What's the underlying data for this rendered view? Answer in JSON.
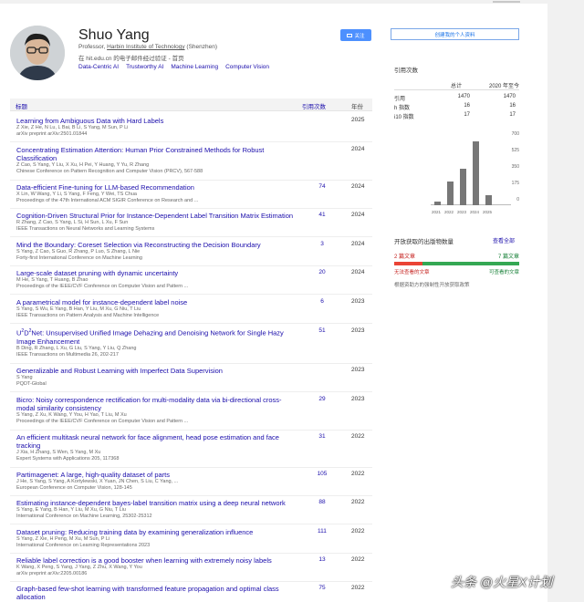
{
  "profile": {
    "name": "Shuo Yang",
    "affiliation_prefix": "Professor, ",
    "affiliation_link": "Harbin Institute of Technology",
    "affiliation_suffix": " (Shenzhen)",
    "email": "在 hit.edu.cn 的电子邮件经过验证 - 首页",
    "interests": [
      "Data-Centric AI",
      "Trustworthy AI",
      "Machine Learning",
      "Computer Vision"
    ],
    "follow_label": "关注",
    "create_profile_label": "创建我的个人资料"
  },
  "table": {
    "col_title": "标题",
    "col_cited": "引用次数",
    "col_year": "年份"
  },
  "publications": [
    {
      "title": "Learning from Ambiguous Data with Hard Labels",
      "authors": "Z Xie, Z He, N Lu, L Bai, B Li, S Yang, M Sun, P Li",
      "venue": "arXiv preprint arXiv:2501.01844",
      "cited": "",
      "year": "2025"
    },
    {
      "title": "Concentrating Estimation Attention: Human Prior Constrained Methods for Robust Classification",
      "authors": "Z Cao, S Yang, Y Liu, X Xu, H Pei, Y Huang, Y Yu, R Zhang",
      "venue": "Chinese Conference on Pattern Recognition and Computer Vision (PRCV), 567-588",
      "cited": "",
      "year": "2024"
    },
    {
      "title": "Data-efficient Fine-tuning for LLM-based Recommendation",
      "authors": "X Lin, W Wang, Y Li, S Yang, F Feng, Y Wei, TS Chua",
      "venue": "Proceedings of the 47th International ACM SIGIR Conference on Research and ...",
      "cited": "74",
      "year": "2024"
    },
    {
      "title": "Cognition-Driven Structural Prior for Instance-Dependent Label Transition Matrix Estimation",
      "authors": "R Zhang, Z Cao, S Yang, L Si, H Sun, L Xu, F Sun",
      "venue": "IEEE Transactions on Neural Networks and Learning Systems",
      "cited": "41",
      "year": "2024"
    },
    {
      "title": "Mind the Boundary: Coreset Selection via Reconstructing the Decision Boundary",
      "authors": "S Yang, Z Cao, S Guo, R Zhang, P Luo, S Zhang, L Nie",
      "venue": "Forty-first International Conference on Machine Learning",
      "cited": "3",
      "year": "2024"
    },
    {
      "title": "Large-scale dataset pruning with dynamic uncertainty",
      "authors": "M He, S Yang, T Huang, B Zhao",
      "venue": "Proceedings of the IEEE/CVF Conference on Computer Vision and Pattern ...",
      "cited": "20",
      "year": "2024"
    },
    {
      "title": "A parametrical model for instance-dependent label noise",
      "authors": "S Yang, S Wu, E Yang, B Han, Y Liu, M Xu, G Niu, T Liu",
      "venue": "IEEE Transactions on Pattern Analysis and Machine Intelligence",
      "cited": "6",
      "year": "2023"
    },
    {
      "title_pre": "U",
      "title_sup1": "2",
      "title_mid": "D",
      "title_sup2": "2",
      "title_post": "Net: Unsupervised Unified Image Dehazing and Denoising Network for Single Hazy Image Enhancement",
      "authors": "B Ding, R Zhang, L Xu, G Liu, S Yang, Y Liu, Q Zhang",
      "venue": "IEEE Transactions on Multimedia 26, 202-217",
      "cited": "51",
      "year": "2023"
    },
    {
      "title": "Generalizable and Robust Learning with Imperfect Data Supervision",
      "authors": "S Yang",
      "venue": "PQDT-Global",
      "cited": "",
      "year": "2023"
    },
    {
      "title": "Bicro: Noisy correspondence rectification for multi-modality data via bi-directional cross-modal similarity consistency",
      "authors": "S Yang, Z Xu, K Wang, Y You, H Yao, T Liu, M Xu",
      "venue": "Proceedings of the IEEE/CVF Conference on Computer Vision and Pattern ...",
      "cited": "29",
      "year": "2023"
    },
    {
      "title": "An efficient multitask neural network for face alignment, head pose estimation and face tracking",
      "authors": "J Xia, H Zhang, S Wen, S Yang, M Xu",
      "venue": "Expert Systems with Applications 205, 117368",
      "cited": "31",
      "year": "2022"
    },
    {
      "title": "Partimagenet: A large, high-quality dataset of parts",
      "authors": "J He, S Yang, S Yang, A Kortylewski, X Yuan, JN Chen, S Liu, C Yang, ...",
      "venue": "European Conference on Computer Vision, 128-145",
      "cited": "105",
      "year": "2022"
    },
    {
      "title": "Estimating instance-dependent bayes-label transition matrix using a deep neural network",
      "authors": "S Yang, E Yang, B Han, Y Liu, M Xu, G Niu, T Liu",
      "venue": "International Conference on Machine Learning, 25302-25312",
      "cited": "88",
      "year": "2022"
    },
    {
      "title": "Dataset pruning: Reducing training data by examining generalization influence",
      "authors": "S Yang, Z Xie, H Peng, M Xu, M Sun, P Li",
      "venue": "International Conference on Learning Representations 2023",
      "cited": "111",
      "year": "2022"
    },
    {
      "title": "Reliable label correction is a good booster when learning with extremely noisy labels",
      "authors": "K Wang, X Peng, S Yang, J Yang, Z Zhu, X Wang, Y You",
      "venue": "arXiv preprint arXiv:2205.00186",
      "cited": "13",
      "year": "2022"
    },
    {
      "title": "Graph-based few-shot learning with transformed feature propagation and optimal class allocation",
      "authors": "",
      "venue": "",
      "cited": "75",
      "year": "2022"
    }
  ],
  "stats": {
    "title": "引用次数",
    "col_all": "总计",
    "col_since": "2020 年至今",
    "rows": [
      {
        "label": "引用",
        "all": "1470",
        "since": "1470"
      },
      {
        "label": "h 指数",
        "all": "16",
        "since": "16"
      },
      {
        "label": "i10 指数",
        "all": "17",
        "since": "17"
      }
    ]
  },
  "chart_data": {
    "type": "bar",
    "categories": [
      "2021",
      "2022",
      "2023",
      "2024",
      "2025"
    ],
    "values": [
      40,
      250,
      390,
      680,
      110
    ],
    "ylim": [
      0,
      700
    ],
    "yticks": [
      "700",
      "525",
      "350",
      "175",
      "0"
    ],
    "bar_color": "#777777"
  },
  "open_access": {
    "title": "开放获取的出版物数量",
    "view_all": "查看全部",
    "left": "2 篇文章",
    "right": "7 篇文章",
    "left_status": "无法查看的文章",
    "right_status": "可查看的文章",
    "note": "根据资助方的强制性开放获取政策"
  },
  "watermark": "头条 @火星X计划"
}
